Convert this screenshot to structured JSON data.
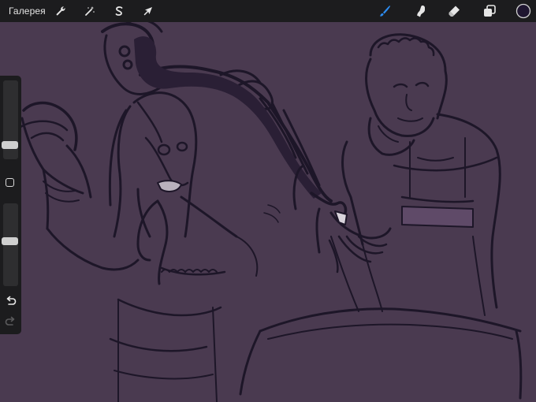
{
  "toolbar": {
    "gallery_label": "Галерея",
    "left_tools": [
      {
        "name": "actions",
        "icon": "wrench-icon"
      },
      {
        "name": "adjustments",
        "icon": "magic-wand-icon"
      },
      {
        "name": "selection",
        "icon": "selection-s-icon"
      },
      {
        "name": "transform",
        "icon": "arrow-cursor-icon"
      }
    ],
    "right_tools": [
      {
        "name": "brush",
        "icon": "brush-icon",
        "active": true
      },
      {
        "name": "smudge",
        "icon": "smudge-finger-icon"
      },
      {
        "name": "eraser",
        "icon": "eraser-icon"
      },
      {
        "name": "layers",
        "icon": "layers-icon"
      },
      {
        "name": "color",
        "icon": "color-swatch"
      }
    ]
  },
  "colors": {
    "toolbar_bg": "#1c1c1e",
    "canvas_bg": "#4a3a50",
    "active_tool": "#2d8cf0",
    "current_color": "#1f1630",
    "stroke": "#1d1628"
  },
  "sidebar": {
    "brush_size_level": 0.87,
    "opacity_level": 0.56,
    "modify_button": "square-icon",
    "undo": "undo-icon",
    "redo": "redo-icon"
  }
}
